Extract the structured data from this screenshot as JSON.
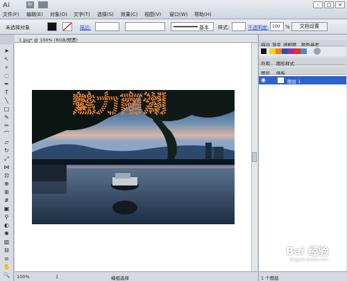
{
  "app": {
    "logo": "Ai",
    "bridge": "Br"
  },
  "menu": [
    "文件(F)",
    "编辑(E)",
    "对象(O)",
    "文字(T)",
    "选择(S)",
    "效果(C)",
    "视图(V)",
    "窗口(W)",
    "帮助(H)"
  ],
  "window_controls": [
    "-",
    "□",
    "×"
  ],
  "control_bar": {
    "selection": "未选择对象",
    "stroke_label": "描边:",
    "line_style": "基本",
    "style_label": "样式:",
    "opacity_label": "不透明度:",
    "opacity_value": "100",
    "opacity_unit": "%",
    "doc_settings": "文档设置"
  },
  "document": {
    "tab_title": "1.jpg* @ 100% (RGB/预览)",
    "close_glyph": "×",
    "photo_text": "魅力南湖"
  },
  "status": {
    "zoom": "100%",
    "page": "1",
    "mode": "编组选择"
  },
  "panels": {
    "tabs1": [
      "描边",
      "渐变",
      "透明度"
    ],
    "tab_color": "颜色参考",
    "tabs2": [
      "外观",
      "图形样式"
    ],
    "layer_tabs": [
      "图层",
      "画板"
    ],
    "layer_name": "图层 1",
    "layer_count": "1 个图层"
  },
  "colors": {
    "accent": "#2f62c9",
    "swatches": [
      "#f3d21a",
      "#ef7e1d",
      "#2e4fb3",
      "#9b2f9e",
      "#e0321f",
      "#4a86c8"
    ]
  },
  "watermark": {
    "brand": "Bai 经验",
    "url": "jingyan.baidu.com"
  }
}
